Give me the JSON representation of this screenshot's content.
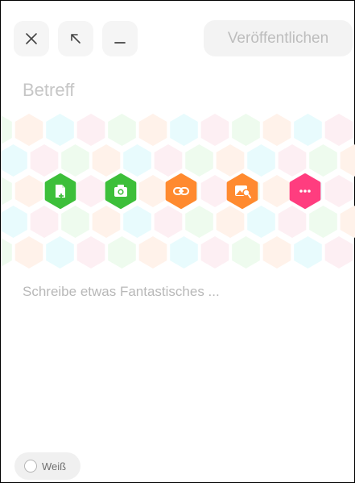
{
  "toolbar": {
    "close_icon": "close-icon",
    "expand_icon": "expand-arrow-icon",
    "minimize_icon": "minimize-icon",
    "publish_label": "Veröffentlichen"
  },
  "subject": {
    "placeholder": "Betreff"
  },
  "attachments": [
    {
      "name": "file-icon",
      "color": "#3dbf3a"
    },
    {
      "name": "camera-icon",
      "color": "#3dbf3a"
    },
    {
      "name": "link-icon",
      "color": "#ff8a2f"
    },
    {
      "name": "image-search-icon",
      "color": "#ff8a2f"
    },
    {
      "name": "more-icon",
      "color": "#ff3d7f"
    }
  ],
  "hex_colors": [
    "#fff2ea",
    "#e8fbfd",
    "#fdeff3",
    "#eefbee"
  ],
  "editor": {
    "placeholder": "Schreibe etwas Fantastisches ..."
  },
  "background_toggle": {
    "label": "Weiß"
  }
}
